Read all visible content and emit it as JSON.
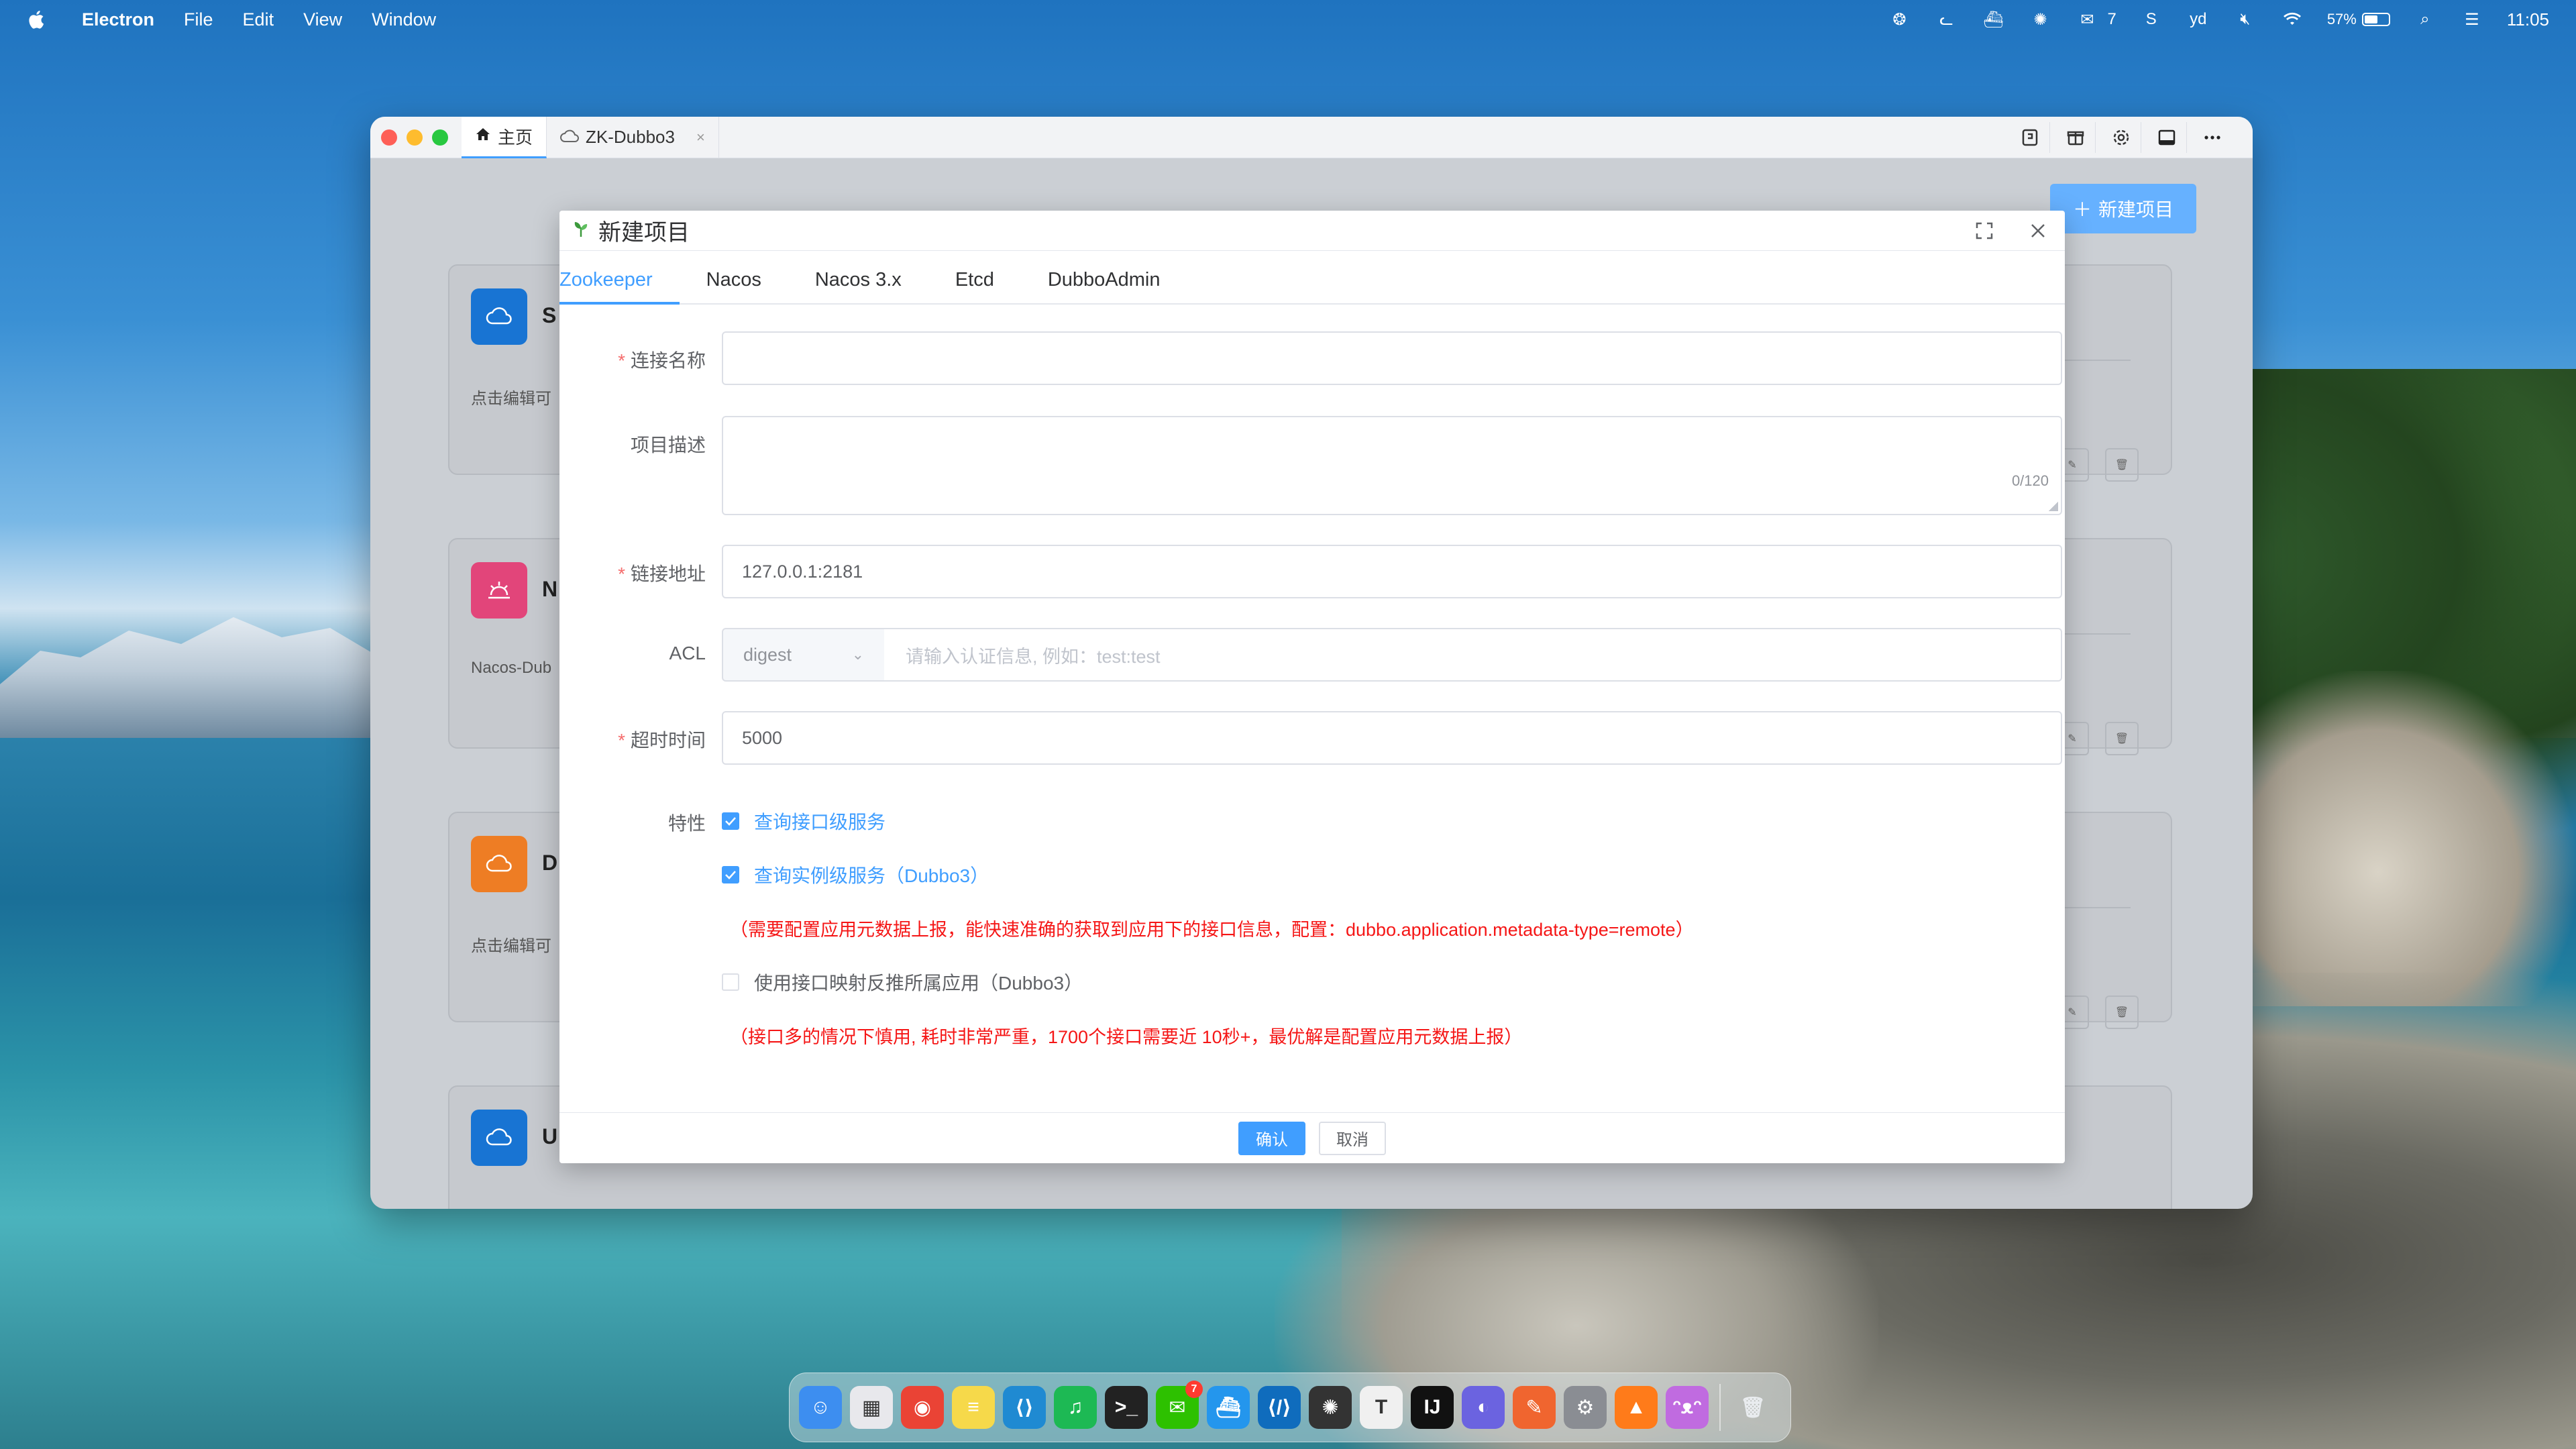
{
  "menubar": {
    "app_name": "Electron",
    "menus": [
      "File",
      "Edit",
      "View",
      "Window"
    ],
    "wechat_count": "7",
    "battery": "57%",
    "battery_level": 0.57,
    "clock": "11:05"
  },
  "window": {
    "tabs": [
      {
        "label": "主页",
        "icon": "home-icon",
        "active": true
      },
      {
        "label": "ZK-Dubbo3",
        "icon": "cloud-icon",
        "active": false
      }
    ],
    "new_project_label": "新建项目"
  },
  "cards": [
    {
      "title": "S",
      "desc": "点击编辑可",
      "color": "#1874d3",
      "icon": "cloud-icon"
    },
    {
      "title": "N",
      "desc": "Nacos-Dub",
      "color": "#e2457a",
      "icon": "sunrise-icon"
    },
    {
      "title": "D",
      "desc": "点击编辑可",
      "color": "#ee7d24",
      "icon": "cloud-icon"
    },
    {
      "title": "U",
      "desc": "",
      "color": "#1874d3",
      "icon": "cloud-icon"
    }
  ],
  "modal": {
    "title": "新建项目",
    "tabs": [
      "Zookeeper",
      "Nacos",
      "Nacos 3.x",
      "Etcd",
      "DubboAdmin"
    ],
    "active_tab": 0,
    "fields": {
      "name_label": "连接名称",
      "name_value": "",
      "desc_label": "项目描述",
      "desc_counter": "0/120",
      "address_label": "链接地址",
      "address_value": "127.0.0.1:2181",
      "acl_label": "ACL",
      "acl_select": "digest",
      "acl_placeholder": "请输入认证信息, 例如：test:test",
      "timeout_label": "超时时间",
      "timeout_value": "5000",
      "feature_label": "特性"
    },
    "features": [
      {
        "label": "查询接口级服务",
        "checked": true
      },
      {
        "label": "查询实例级服务（Dubbo3）",
        "checked": true
      },
      {
        "label": "使用接口映射反推所属应用（Dubbo3）",
        "checked": false
      }
    ],
    "notes": [
      "（需要配置应用元数据上报，能快速准确的获取到应用下的接口信息，配置：dubbo.application.metadata-type=remote）",
      "（接口多的情况下慎用, 耗时非常严重，1700个接口需要近 10秒+，最优解是配置应用元数据上报）"
    ],
    "confirm_label": "确认",
    "cancel_label": "取消"
  },
  "dock": {
    "apps": [
      {
        "name": "finder",
        "glyph": "☺",
        "color": "#3d8ef0"
      },
      {
        "name": "launchpad",
        "glyph": "▦",
        "color": "#e8e8ec"
      },
      {
        "name": "chrome",
        "glyph": "◉",
        "color": "#ea4335"
      },
      {
        "name": "notes",
        "glyph": "≡",
        "color": "#f6d94a"
      },
      {
        "name": "vscode",
        "glyph": "⟨⟩",
        "color": "#1f8ad2"
      },
      {
        "name": "spotify",
        "glyph": "♫",
        "color": "#1db954"
      },
      {
        "name": "terminal",
        "glyph": ">_",
        "color": "#222"
      },
      {
        "name": "wechat",
        "glyph": "✉",
        "color": "#2dc100",
        "badge": "7"
      },
      {
        "name": "docker",
        "glyph": "⛴",
        "color": "#2496ed"
      },
      {
        "name": "devtools",
        "glyph": "⟨/⟩",
        "color": "#0f6cbd"
      },
      {
        "name": "chatgpt",
        "glyph": "✺",
        "color": "#333"
      },
      {
        "name": "typora",
        "glyph": "T",
        "color": "#f0f0f0"
      },
      {
        "name": "intellij",
        "glyph": "IJ",
        "color": "#111"
      },
      {
        "name": "proxy",
        "glyph": "◐",
        "color": "#6b63e0"
      },
      {
        "name": "paw",
        "glyph": "✎",
        "color": "#f0652f"
      },
      {
        "name": "system-prefs",
        "glyph": "⚙",
        "color": "#8a8d93"
      },
      {
        "name": "toolbox",
        "glyph": "▲",
        "color": "#ff7b1a"
      },
      {
        "name": "cat-app",
        "glyph": "ᵔᴥᵔ",
        "color": "#c06be0"
      }
    ],
    "trash": "trash"
  }
}
